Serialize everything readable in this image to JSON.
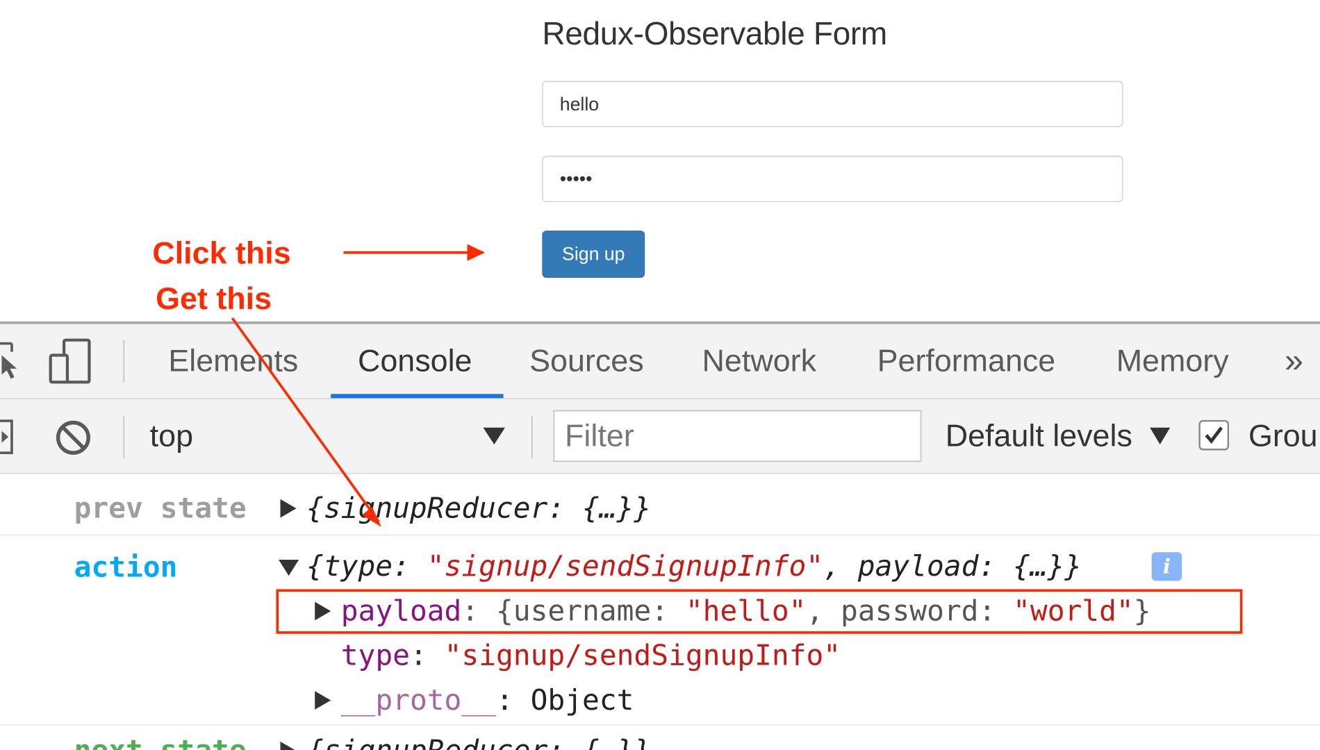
{
  "form": {
    "title": "Redux-Observable Form",
    "username_value": "hello",
    "password_value": "world",
    "signup_label": "Sign up"
  },
  "annotations": {
    "click_this": "Click this",
    "get_this": "Get this",
    "color": "#ff2a00"
  },
  "devtools": {
    "tabs": [
      "Elements",
      "Console",
      "Sources",
      "Network",
      "Performance",
      "Memory"
    ],
    "active_tab": "Console",
    "more_tabs_glyph": "»",
    "context": "top",
    "filter_placeholder": "Filter",
    "levels_label": "Default levels",
    "group_label": "Grou",
    "accent": "#1a73e8"
  },
  "console": {
    "prev_label": "prev state",
    "prev_value": "{signupReducer: {…}}",
    "action_label": "action",
    "action_open": "{type: ",
    "action_type": "\"signup/sendSignupInfo\"",
    "action_rest": ", payload: {…}}",
    "info_badge": "i",
    "payload_key": "payload",
    "payload_open": ": {username: ",
    "payload_username": "\"hello\"",
    "payload_mid": ", password: ",
    "payload_password": "\"world\"",
    "payload_close": "}",
    "type_key": "type",
    "type_colon": ": ",
    "type_value": "\"signup/sendSignupInfo\"",
    "proto_key": "__proto__",
    "proto_value": ": Object",
    "next_label": "next state",
    "next_value": "{signupReducer: {…}}"
  }
}
